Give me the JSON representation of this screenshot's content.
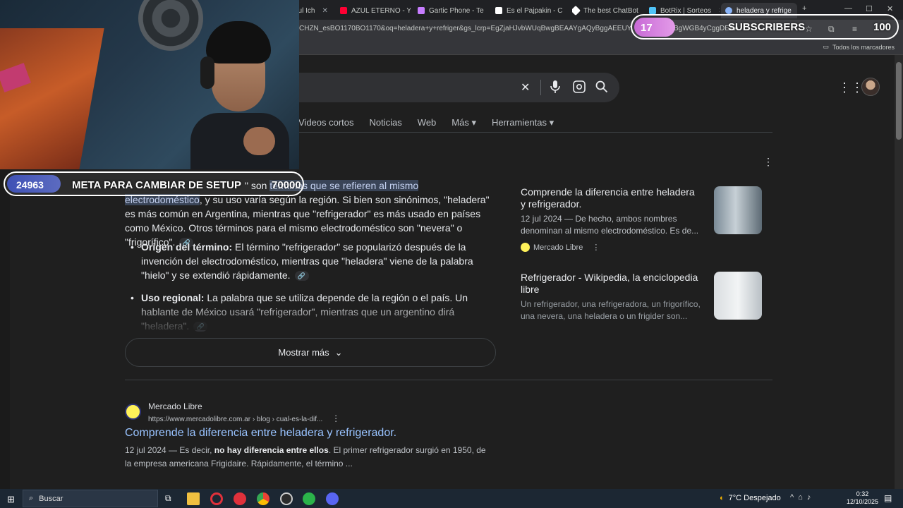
{
  "tabs": [
    {
      "label": "azul Ich",
      "favicon_color": "#ff0000"
    },
    {
      "label": "AZUL ETERNO - Y",
      "favicon_color": "#ff0033"
    },
    {
      "label": "Gartic Phone - Te",
      "favicon_color": "#c77dff"
    },
    {
      "label": "Es el Pajpakin - C",
      "favicon_color": "#ffffff"
    },
    {
      "label": "The best ChatBot",
      "favicon_color": "#ffffff"
    },
    {
      "label": "BotRix | Sorteos",
      "favicon_color": "#4fc3f7"
    },
    {
      "label": "heladera y refrige",
      "favicon_color": "#8ab4f8"
    }
  ],
  "window_controls": {
    "minimize": "—",
    "maximize": "☐",
    "close": "✕",
    "new_tab": "+"
  },
  "address": {
    "url_fragment": "CHZN_esBO1170BO1170&oq=heladera+y+refriger&gs_lcrp=EgZjaHJvbWUqBwgBEAAYgAQyBggAEEUYOTIHCAEQ",
    "url_tail": "BgWGB4yCggDEAA"
  },
  "bookmarks": {
    "all_label": "Todos los marcadores"
  },
  "search": {
    "clear_icon": "✕",
    "mic_icon": "🎤",
    "lens_icon": "⊡",
    "search_icon": "⌕"
  },
  "nav": {
    "items": [
      "Videos cortos",
      "Noticias",
      "Web",
      "Más ▾",
      "Herramientas ▾"
    ]
  },
  "overview": {
    "prefix": "\" son ",
    "highlight_a": "términos que se refieren al mismo",
    "highlight_b": "electrodoméstico",
    "text_1": ", y su uso varía según la región. Si bien son sinónimos, \"heladera\" es más común en Argentina, mientras que \"refrigerador\" es más usado en países como México. Otros términos para el mismo electrodoméstico son \"nevera\" o \"frigorífico\".",
    "bullets": [
      {
        "label": "Origen del término:",
        "text": " El término \"refrigerador\" se popularizó después de la invención del electrodoméstico, mientras que \"heladera\" viene de la palabra \"hielo\" y se extendió rápidamente."
      },
      {
        "label": "Uso regional:",
        "text": " La palabra que se utiliza depende de la región o el país. Un hablante de México usará \"refrigerador\", mientras que un argentino dirá \"heladera\"."
      }
    ],
    "show_more": "Mostrar más"
  },
  "cards": [
    {
      "title": "Comprende la diferencia entre heladera y refrigerador.",
      "snippet": "12 jul 2024 — De hecho, ambos nombres denominan al mismo electrodoméstico. Es de...",
      "source": "Mercado Libre"
    },
    {
      "title": "Refrigerador - Wikipedia, la enciclopedia libre",
      "snippet": "Un refrigerador, una refrigeradora, un frigorífico, una nevera, una heladera o un frigider son..."
    }
  ],
  "result": {
    "site": "Mercado Libre",
    "url": "https://www.mercadolibre.com.ar › blog › cual-es-la-dif...",
    "title": "Comprende la diferencia entre heladera y refrigerador.",
    "date": "12 jul 2024 — ",
    "snippet_a": "Es decir, ",
    "snippet_bold": "no hay diferencia entre ellos",
    "snippet_b": ". El primer refrigerador surgió en 1950, de la empresa americana Frigidaire. Rápidamente, el término ..."
  },
  "stream": {
    "meta_count": "24963",
    "meta_label": "META PARA CAMBIAR DE SETUP",
    "meta_goal": "70000",
    "sub_count": "17",
    "sub_label": "SUBSCRIBERS",
    "sub_goal": "100"
  },
  "taskbar": {
    "search_label": "Buscar",
    "weather": "7°C  Despejado",
    "time": "0:32",
    "date": "12/10/2025"
  },
  "colors": {
    "link": "#99c3ff",
    "highlight": "#394457",
    "meta_fill": "#3f51b5",
    "sub_fill": "#c86ad6"
  }
}
